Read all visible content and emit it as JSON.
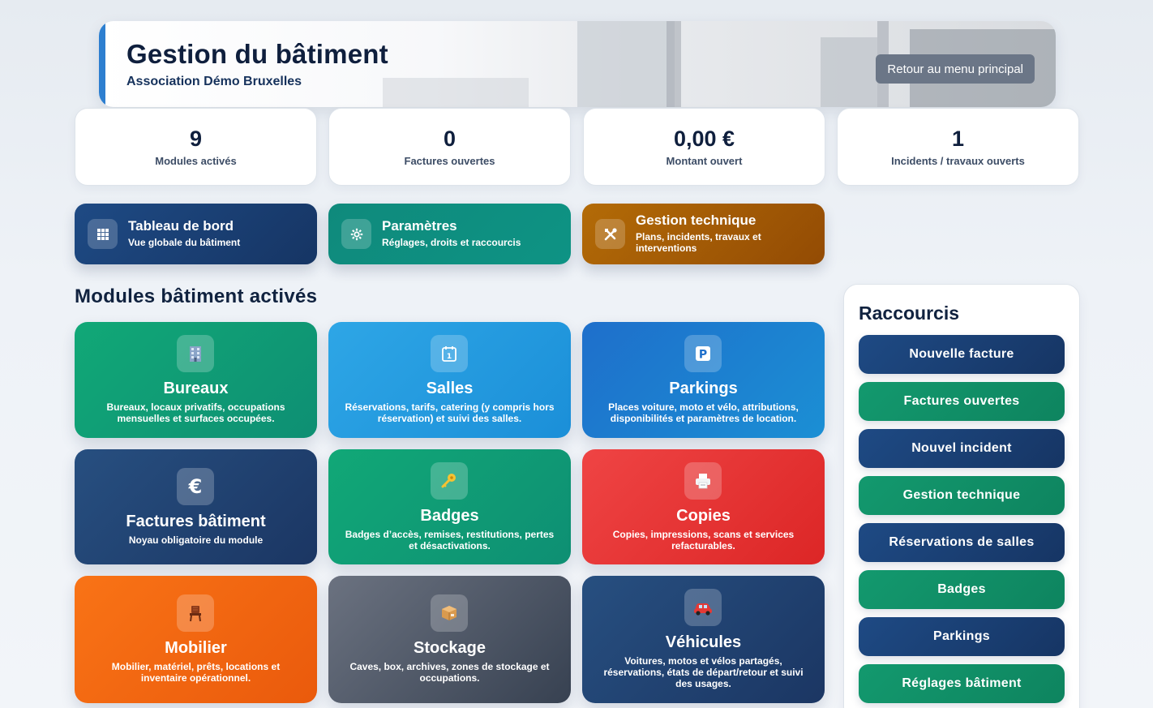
{
  "header": {
    "title": "Gestion du bâtiment",
    "subtitle": "Association Démo Bruxelles",
    "back_label": "Retour au menu principal",
    "accent_color": "#2d7fd0"
  },
  "stats": [
    {
      "value": "9",
      "label": "Modules activés"
    },
    {
      "value": "0",
      "label": "Factures ouvertes"
    },
    {
      "value": "0,00 €",
      "label": "Montant ouvert"
    },
    {
      "value": "1",
      "label": "Incidents / travaux ouverts"
    }
  ],
  "quick_nav": [
    {
      "title": "Tableau de bord",
      "subtitle": "Vue globale du bâtiment",
      "icon": "grid-icon",
      "color": "#1b3663"
    },
    {
      "title": "Paramètres",
      "subtitle": "Réglages, droits et raccourcis",
      "icon": "gear-icon",
      "color": "#0e9384"
    },
    {
      "title": "Gestion technique",
      "subtitle": "Plans, incidents, travaux et interventions",
      "icon": "tools-icon",
      "color": "#934b04"
    }
  ],
  "modules_section_title": "Modules bâtiment activés",
  "modules": [
    {
      "title": "Bureaux",
      "description": "Bureaux, locaux privatifs, occupations mensuelles et surfaces occupées.",
      "icon": "office-building-icon",
      "color": "#11a877"
    },
    {
      "title": "Salles",
      "description": "Réservations, tarifs, catering (y compris hors réservation) et suivi des salles.",
      "icon": "calendar-icon",
      "color": "#2ea6e6"
    },
    {
      "title": "Parkings",
      "description": "Places voiture, moto et vélo, attributions, disponibilités et paramètres de location.",
      "icon": "parking-icon",
      "color": "#1e6fcb"
    },
    {
      "title": "Factures bâtiment",
      "description": "Noyau obligatoire du module",
      "icon": "euro-icon",
      "color": "#274f80"
    },
    {
      "title": "Badges",
      "description": "Badges d’accès, remises, restitutions, pertes et désactivations.",
      "icon": "key-icon",
      "color": "#11a877"
    },
    {
      "title": "Copies",
      "description": "Copies, impressions, scans et services refacturables.",
      "icon": "printer-icon",
      "color": "#ef4444"
    },
    {
      "title": "Mobilier",
      "description": "Mobilier, matériel, prêts, locations et inventaire opérationnel.",
      "icon": "chair-icon",
      "color": "#f97316"
    },
    {
      "title": "Stockage",
      "description": "Caves, box, archives, zones de stockage et occupations.",
      "icon": "box-icon",
      "color": "#6b7280"
    },
    {
      "title": "Véhicules",
      "description": "Voitures, motos et vélos partagés, réservations, états de départ/retour et suivi des usages.",
      "icon": "car-icon",
      "color": "#274f80"
    }
  ],
  "shortcuts": {
    "title": "Raccourcis",
    "items": [
      {
        "label": "Nouvelle facture",
        "color": "#1b3663"
      },
      {
        "label": "Factures ouvertes",
        "color": "#0e845f"
      },
      {
        "label": "Nouvel incident",
        "color": "#1b3663"
      },
      {
        "label": "Gestion technique",
        "color": "#0e845f"
      },
      {
        "label": "Réservations de salles",
        "color": "#1b3663"
      },
      {
        "label": "Badges",
        "color": "#0e845f"
      },
      {
        "label": "Parkings",
        "color": "#1b3663"
      },
      {
        "label": "Réglages bâtiment",
        "color": "#0e845f"
      }
    ]
  }
}
